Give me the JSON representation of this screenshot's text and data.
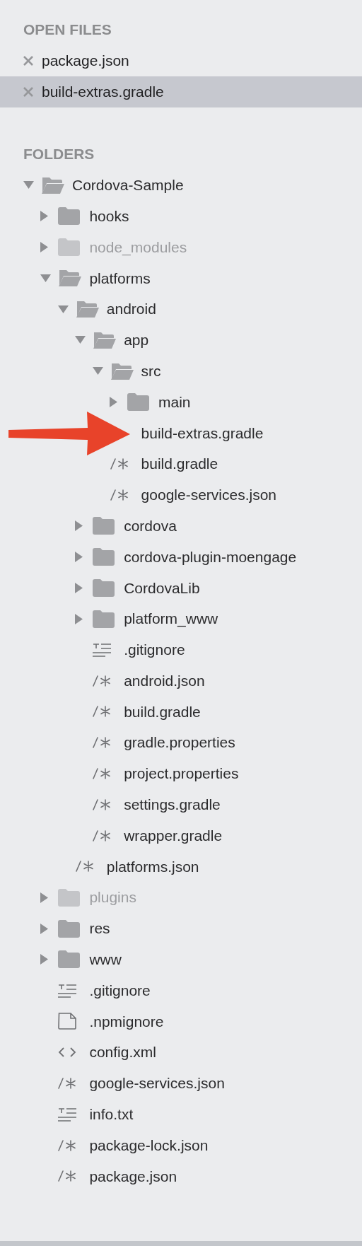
{
  "open_files": {
    "title": "OPEN FILES",
    "items": [
      {
        "name": "package.json",
        "selected": false
      },
      {
        "name": "build-extras.gradle",
        "selected": true
      }
    ]
  },
  "folders": {
    "title": "FOLDERS",
    "tree": [
      {
        "name": "Cordova-Sample",
        "kind": "folder",
        "expanded": true,
        "dimmed": false,
        "children": [
          {
            "name": "hooks",
            "kind": "folder",
            "expanded": false,
            "dimmed": false
          },
          {
            "name": "node_modules",
            "kind": "folder",
            "expanded": false,
            "dimmed": true
          },
          {
            "name": "platforms",
            "kind": "folder",
            "expanded": true,
            "dimmed": false,
            "children": [
              {
                "name": "android",
                "kind": "folder",
                "expanded": true,
                "dimmed": false,
                "children": [
                  {
                    "name": "app",
                    "kind": "folder",
                    "expanded": true,
                    "dimmed": false,
                    "children": [
                      {
                        "name": "src",
                        "kind": "folder",
                        "expanded": true,
                        "dimmed": false,
                        "children": [
                          {
                            "name": "main",
                            "kind": "folder",
                            "expanded": false,
                            "dimmed": false
                          }
                        ]
                      },
                      {
                        "name": "build-extras.gradle",
                        "kind": "covered",
                        "dimmed": false
                      },
                      {
                        "name": "build.gradle",
                        "kind": "code",
                        "dimmed": false
                      },
                      {
                        "name": "google-services.json",
                        "kind": "code",
                        "dimmed": false
                      }
                    ]
                  },
                  {
                    "name": "cordova",
                    "kind": "folder",
                    "expanded": false,
                    "dimmed": false
                  },
                  {
                    "name": "cordova-plugin-moengage",
                    "kind": "folder",
                    "expanded": false,
                    "dimmed": false
                  },
                  {
                    "name": "CordovaLib",
                    "kind": "folder",
                    "expanded": false,
                    "dimmed": false
                  },
                  {
                    "name": "platform_www",
                    "kind": "folder",
                    "expanded": false,
                    "dimmed": false
                  },
                  {
                    "name": ".gitignore",
                    "kind": "text",
                    "dimmed": false
                  },
                  {
                    "name": "android.json",
                    "kind": "code",
                    "dimmed": false
                  },
                  {
                    "name": "build.gradle",
                    "kind": "code",
                    "dimmed": false
                  },
                  {
                    "name": "gradle.properties",
                    "kind": "code",
                    "dimmed": false
                  },
                  {
                    "name": "project.properties",
                    "kind": "code",
                    "dimmed": false
                  },
                  {
                    "name": "settings.gradle",
                    "kind": "code",
                    "dimmed": false
                  },
                  {
                    "name": "wrapper.gradle",
                    "kind": "code",
                    "dimmed": false
                  }
                ]
              },
              {
                "name": "platforms.json",
                "kind": "code",
                "dimmed": false
              }
            ]
          },
          {
            "name": "plugins",
            "kind": "folder",
            "expanded": false,
            "dimmed": true
          },
          {
            "name": "res",
            "kind": "folder",
            "expanded": false,
            "dimmed": false
          },
          {
            "name": "www",
            "kind": "folder",
            "expanded": false,
            "dimmed": false
          },
          {
            "name": ".gitignore",
            "kind": "text",
            "dimmed": false
          },
          {
            "name": ".npmignore",
            "kind": "file",
            "dimmed": false
          },
          {
            "name": "config.xml",
            "kind": "markup",
            "dimmed": false
          },
          {
            "name": "google-services.json",
            "kind": "code",
            "dimmed": false
          },
          {
            "name": "info.txt",
            "kind": "text",
            "dimmed": false
          },
          {
            "name": "package-lock.json",
            "kind": "code",
            "dimmed": false
          },
          {
            "name": "package.json",
            "kind": "code",
            "dimmed": false
          }
        ]
      }
    ]
  }
}
